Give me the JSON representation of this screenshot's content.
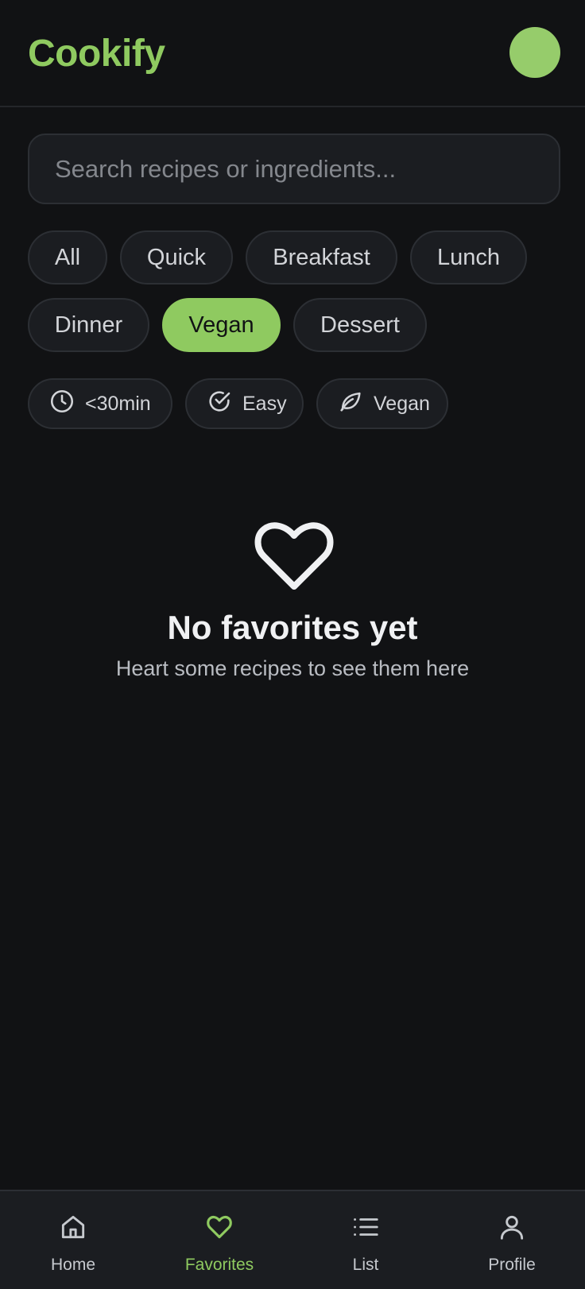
{
  "app": {
    "title": "Cookify",
    "accent": "#8fca60"
  },
  "search": {
    "placeholder": "Search recipes or ingredients...",
    "value": ""
  },
  "categories": [
    {
      "label": "All",
      "active": false
    },
    {
      "label": "Quick",
      "active": false
    },
    {
      "label": "Breakfast",
      "active": false
    },
    {
      "label": "Lunch",
      "active": false
    },
    {
      "label": "Dinner",
      "active": false
    },
    {
      "label": "Vegan",
      "active": true
    },
    {
      "label": "Dessert",
      "active": false
    }
  ],
  "quick_filters": [
    {
      "label": "<30min",
      "icon": "clock-icon"
    },
    {
      "label": "Easy",
      "icon": "check-circle-icon"
    },
    {
      "label": "Vegan",
      "icon": "leaf-icon"
    }
  ],
  "empty_state": {
    "icon": "heart-outline-icon",
    "title": "No favorites yet",
    "subtitle": "Heart some recipes to see them here"
  },
  "nav": {
    "items": [
      {
        "label": "Home",
        "icon": "home-icon",
        "active": false
      },
      {
        "label": "Favorites",
        "icon": "heart-icon",
        "active": true
      },
      {
        "label": "List",
        "icon": "list-icon",
        "active": false
      },
      {
        "label": "Profile",
        "icon": "user-icon",
        "active": false
      }
    ]
  }
}
